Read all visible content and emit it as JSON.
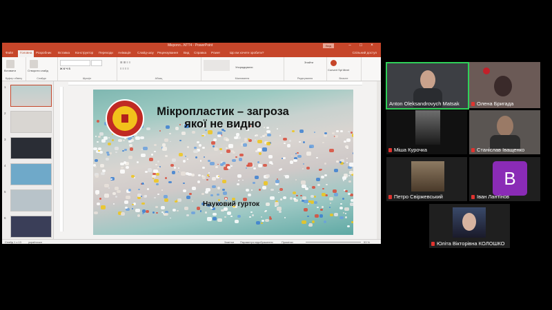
{
  "ppt": {
    "window_title": "Мікропл...NTT4 - PowerPoint",
    "login": "Вхід",
    "tabs": [
      "Файл",
      "Головна",
      "Розробник",
      "Вставка",
      "Конструктор",
      "Переходи",
      "Анімація",
      "Слайд-шоу",
      "Рецензування",
      "Вид",
      "Справка",
      "Power",
      "Що ви хочете зробити?"
    ],
    "active_tab": "Головна",
    "share": "Спільний доступ",
    "ribbon_groups": [
      {
        "label": "Буфер обміну",
        "btn": "Вставити"
      },
      {
        "label": "Слайди",
        "btn": "Створити слайд"
      },
      {
        "label": "Шрифт",
        "btn": "Шрифт"
      },
      {
        "label": "Абзац",
        "btn": "Абзац"
      },
      {
        "label": "Малювання",
        "btn": "Упорядкувати"
      },
      {
        "label": "Редагування",
        "btn": "Знайти"
      },
      {
        "label": "Власне",
        "btn": "Convert Spl Meet"
      }
    ],
    "slide": {
      "title": "Мікропластик – загроза якої не видно",
      "subtitle": "Науковий гурток"
    },
    "thumbnails": [
      "1",
      "2",
      "3",
      "4",
      "5",
      "6"
    ],
    "status": {
      "slide_info": "Слайд 1 з 13",
      "language": "українська",
      "notes": "Замітки",
      "comments": "Параметри відображення",
      "view": "Примітки",
      "zoom": "53 %"
    }
  },
  "participants": [
    {
      "name": "Anton Oleksandrovych Matsak",
      "muted": false
    },
    {
      "name": "Олена Бригада",
      "muted": true
    },
    {
      "name": "Міша Курочка",
      "muted": true
    },
    {
      "name": "Станіслав Іващенко",
      "muted": true
    },
    {
      "name": "Петро Свіржевський",
      "muted": true
    },
    {
      "name": "Іван Лантінов",
      "muted": true,
      "avatar_letter": "B"
    },
    {
      "name": "Юліта Вікторівна КОЛОШКО",
      "muted": true
    }
  ],
  "colors": {
    "ppt_accent": "#c6462a",
    "active_speaker": "#2fd159",
    "avatar_bg": "#8a2bb6"
  }
}
